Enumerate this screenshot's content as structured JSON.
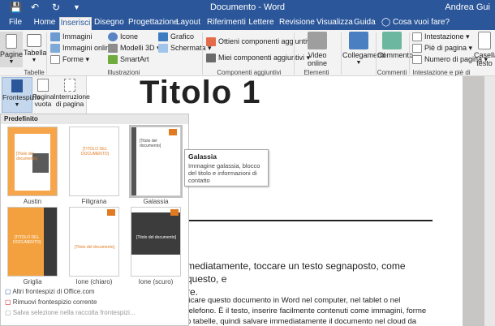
{
  "titlebar": {
    "title": "Documento - Word",
    "user": "Andrea Gui"
  },
  "tabs": [
    {
      "label": "File"
    },
    {
      "label": "Home"
    },
    {
      "label": "Inserisci"
    },
    {
      "label": "Disegno"
    },
    {
      "label": "Progettazione"
    },
    {
      "label": "Layout"
    },
    {
      "label": "Riferimenti"
    },
    {
      "label": "Lettere"
    },
    {
      "label": "Revisione"
    },
    {
      "label": "Visualizza"
    },
    {
      "label": "Guida"
    }
  ],
  "tell_me": "Cosa vuoi fare?",
  "ribbon": {
    "pages": "Pagine",
    "table": "Tabella",
    "images": "Immagini",
    "online_images": "Immagini online",
    "shapes": "Forme",
    "icons": "Icone",
    "models3d": "Modelli 3D",
    "smartart": "SmartArt",
    "chart": "Grafico",
    "screenshot": "Schermata",
    "get_addins": "Ottieni componenti aggiuntivi",
    "my_addins": "Miei componenti aggiuntivi",
    "online_video": "Video online",
    "links": "Collegamenti",
    "comment": "Commento",
    "header": "Intestazione",
    "footer": "Piè di pagina",
    "page_number": "Numero di pagina",
    "textbox": "Casella testo",
    "grp_tables": "Tabelle",
    "grp_illustrations": "Illustrazioni",
    "grp_addins": "Componenti aggiuntivi",
    "grp_media": "Elementi multimediali",
    "grp_comments": "Commenti",
    "grp_headerfooter": "Intestazione e piè di pagina"
  },
  "subribbon": {
    "cover": "Frontespizio",
    "blank": "Pagina vuota",
    "break": "Interruzione di pagina"
  },
  "gallery": {
    "header": "Predefinito",
    "items": [
      {
        "label": "Austin",
        "title": "[Titolo del documento]"
      },
      {
        "label": "Filigrana",
        "title": "[TITOLO DEL DOCUMENTO]"
      },
      {
        "label": "Galassia",
        "title": "[Titolo del documento]"
      },
      {
        "label": "Griglia",
        "title": "[TITOLO DEL DOCUMENTO]"
      },
      {
        "label": "Ione (chiaro)",
        "title": "[Titolo del documento]"
      },
      {
        "label": "Ione (scuro)",
        "title": "[Titolo del documento]"
      }
    ],
    "menu": [
      "Altri frontespizi di Office.com",
      "Rimuovi frontespizio corrente",
      "Salva selezione nella raccolta frontespizi..."
    ]
  },
  "tooltip": {
    "title": "Galassia",
    "desc": "Immagine galassia, blocco del titolo e informazioni di contatto"
  },
  "document": {
    "heading": "Titolo 1",
    "line1": "mediatamente, toccare un testo segnaposto, come questo, e",
    "line1b": "re.",
    "para": "ficare questo documento in Word nel computer, nel tablet o nel telefono. È il testo, inserire facilmente contenuti come immagini, forme o tabelle, quindi salvare immediatamente il documento nel cloud da Word nel dispositivo Windows, Mac, Android o"
  }
}
